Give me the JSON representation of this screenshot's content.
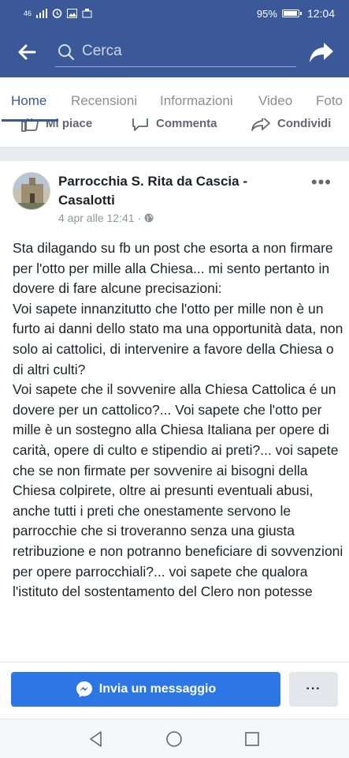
{
  "status_bar": {
    "signal_text": "46",
    "battery": "95%",
    "time": "12:04"
  },
  "header": {
    "search_placeholder": "Cerca",
    "icons": [
      "back-arrow-icon",
      "search-icon",
      "share-icon"
    ]
  },
  "tabs": [
    {
      "label": "Home",
      "active": true
    },
    {
      "label": "Recensioni",
      "active": false
    },
    {
      "label": "Informazioni",
      "active": false
    },
    {
      "label": "Video",
      "active": false
    },
    {
      "label": "Foto",
      "active": false
    }
  ],
  "actions": {
    "like": "Mi piace",
    "comment": "Commenta",
    "share": "Condividi"
  },
  "post": {
    "author": "Parrocchia S. Rita da Cascia - Casalotti",
    "date": "4 apr alle 12:41",
    "separator": "·",
    "privacy_icon": "globe-icon",
    "more": "•••",
    "text": "Sta dilagando su fb un post che esorta a non firmare per l'otto per mille alla Chiesa... mi sento pertanto in dovere di fare alcune precisazioni:\nVoi sapete innanzitutto che l'otto per mille non è un furto ai danni dello stato ma una opportunità data, non solo ai cattolici, di intervenire a favore della Chiesa o di altri culti?\nVoi sapete che il sovvenire alla Chiesa Cattolica é un dovere per un cattolico?...  Voi sapete che l'otto per mille è un sostegno alla Chiesa Italiana per opere di carità,  opere di culto e stipendio ai preti?... voi sapete che se non firmate per sovvenire ai bisogni della Chiesa colpirete, oltre ai presunti eventuali abusi, anche tutti  i preti che onestamente servono le parrocchie che si troveranno senza una giusta retribuzione e non potranno beneficiare di sovvenzioni per opere parrocchiali?... voi sapete che qualora l'istituto del sostentamento del Clero non potesse"
  },
  "cta": {
    "message_label": "Invia un messaggio",
    "more_label": "···"
  },
  "colors": {
    "brand": "#3b5998",
    "cta_blue": "#2d76e6",
    "text": "#1d2129",
    "muted": "#90949c"
  }
}
